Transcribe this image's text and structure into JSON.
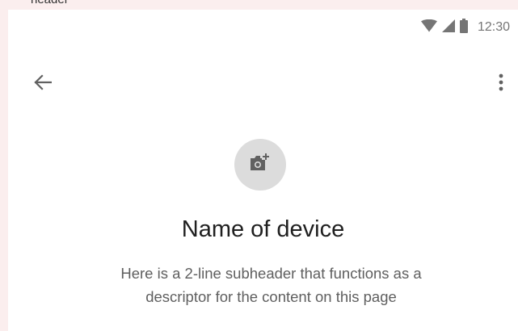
{
  "page": {
    "top_label": "header"
  },
  "status_bar": {
    "time": "12:30",
    "icons": [
      "wifi-icon",
      "signal-icon",
      "battery-icon"
    ]
  },
  "app_bar": {
    "back_icon": "arrow-back-icon",
    "menu_icon": "more-vert-icon"
  },
  "device": {
    "avatar_icon": "add-photo-icon",
    "name": "Name of device",
    "subheader_line1": "Here is a 2-line subheader that functions as a",
    "subheader_line2": "descriptor for the content on this page"
  },
  "colors": {
    "page_background": "#fbeeee",
    "screen_background": "#ffffff",
    "avatar_background": "#dcdcdc",
    "icon_color": "#616161",
    "title_color": "#202020",
    "subheader_color": "#5f5f5f"
  }
}
